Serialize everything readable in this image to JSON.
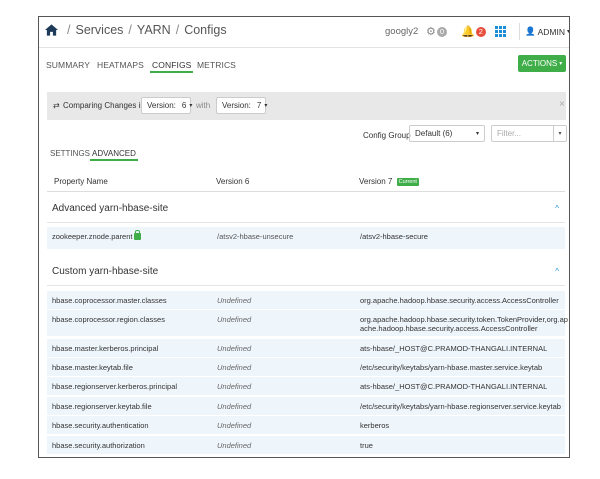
{
  "breadcrumb": {
    "services": "Services",
    "yarn": "YARN",
    "configs": "Configs",
    "sep": "/"
  },
  "topbar": {
    "cluster": "googly2",
    "gear_count": "0",
    "bell_count": "2",
    "admin_label": "ADMIN"
  },
  "tabs": [
    {
      "label": "SUMMARY"
    },
    {
      "label": "HEATMAPS"
    },
    {
      "label": "CONFIGS",
      "active": true
    },
    {
      "label": "METRICS"
    }
  ],
  "actions_label": "ACTIONS",
  "compare": {
    "label": "Comparing Changes in:",
    "version_label_a": "Version:",
    "version_a": "6",
    "with_label": "with",
    "version_label_b": "Version:",
    "version_b": "7",
    "close": "×"
  },
  "config_group": {
    "label": "Config Group",
    "value": "Default (6)",
    "filter_placeholder": "Filter..."
  },
  "subtabs": [
    {
      "label": "SETTINGS"
    },
    {
      "label": "ADVANCED",
      "active": true
    }
  ],
  "columns": {
    "property": "Property Name",
    "v6": "Version 6",
    "v7": "Version 7",
    "current_badge": "Current"
  },
  "sections": [
    {
      "title": "Advanced yarn-hbase-site",
      "rows": [
        {
          "name": "zookeeper.znode.parent",
          "v6": "/atsv2-hbase-unsecure",
          "v7": "/atsv2-hbase-secure"
        }
      ]
    },
    {
      "title": "Custom yarn-hbase-site",
      "rows": [
        {
          "name": "hbase.coprocessor.master.classes",
          "v6": "Undefined",
          "v7": "org.apache.hadoop.hbase.security.access.AccessController"
        },
        {
          "name": "hbase.coprocessor.region.classes",
          "v6": "Undefined",
          "v7": "org.apache.hadoop.hbase.security.token.TokenProvider,org.apache.hadoop.hbase.security.access.AccessController"
        },
        {
          "name": "hbase.master.kerberos.principal",
          "v6": "Undefined",
          "v7": "ats-hbase/_HOST@C.PRAMOD-THANGALI.INTERNAL"
        },
        {
          "name": "hbase.master.keytab.file",
          "v6": "Undefined",
          "v7": "/etc/security/keytabs/yarn-hbase.master.service.keytab"
        },
        {
          "name": "hbase.regionserver.kerberos.principal",
          "v6": "Undefined",
          "v7": "ats-hbase/_HOST@C.PRAMOD-THANGALI.INTERNAL"
        },
        {
          "name": "hbase.regionserver.keytab.file",
          "v6": "Undefined",
          "v7": "/etc/security/keytabs/yarn-hbase.regionserver.service.keytab"
        },
        {
          "name": "hbase.security.authentication",
          "v6": "Undefined",
          "v7": "kerberos"
        },
        {
          "name": "hbase.security.authorization",
          "v6": "Undefined",
          "v7": "true"
        }
      ]
    }
  ]
}
